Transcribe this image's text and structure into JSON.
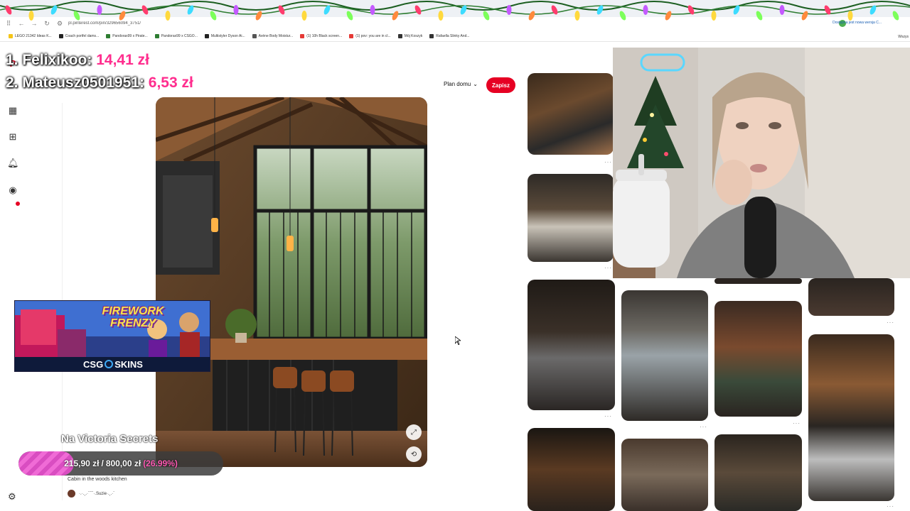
{
  "browser": {
    "url": "pl.pinterest.com/pin/329656094_3751/",
    "right_label": "Dostępna jest nowa wersja C...",
    "right_label2": "Wszys",
    "bookmarks": [
      {
        "label": "LEGO 21342 Ideas K...",
        "color": "#f5c518"
      },
      {
        "label": "Coach portfel dams...",
        "color": "#222222"
      },
      {
        "label": "Pandorax99 x Pirate...",
        "color": "#2e7d32"
      },
      {
        "label": "Pandorax99 x CSGO...",
        "color": "#2e7d32"
      },
      {
        "label": "Multistyler Dyson Ai...",
        "color": "#222222"
      },
      {
        "label": "Avène Body Moistur...",
        "color": "#555555"
      },
      {
        "label": "(1) 10h Black screen...",
        "color": "#e53935"
      },
      {
        "label": "(1) pov: you are in cl...",
        "color": "#e53935"
      },
      {
        "label": "Mój Koszyk",
        "color": "#333333"
      },
      {
        "label": "Rafaella Slinky And...",
        "color": "#333333"
      }
    ]
  },
  "pin": {
    "board_label": "Plan domu",
    "save_label": "Zapisz",
    "title": "Cabin in the woods kitchen",
    "author": "·.·.¸.·´¯`·.Suzie·.¸.·´"
  },
  "overlays": {
    "donors": [
      {
        "rank_name": "1. Felixikoo:",
        "amount": "14,41 zł"
      },
      {
        "rank_name": "2. Mateusz0501951:",
        "amount": "6,53 zł"
      }
    ],
    "ad": {
      "title": "FIREWORK FRENZY",
      "brand_left": "CSG",
      "brand_right": "SKINS"
    },
    "goal": {
      "label": "Na Victoria Secrets",
      "current": "215,90 zł",
      "separator": "/",
      "target": "800,00 zł",
      "percent_text": "(26.99%)",
      "fraction": 0.2699
    }
  },
  "icons": {
    "rail": [
      "pinterest-logo-icon",
      "home-icon",
      "explore-icon",
      "create-icon",
      "notifications-icon",
      "messages-icon",
      "settings-icon"
    ],
    "toolbar": [
      "back-icon",
      "heart-icon",
      "share-icon",
      "more-icon"
    ]
  }
}
